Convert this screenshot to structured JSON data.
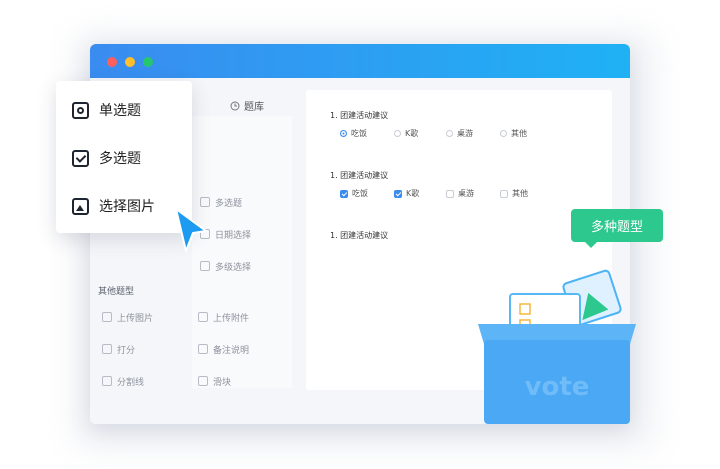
{
  "library": {
    "title": "题库",
    "items": [
      "多选题",
      "日期选择",
      "多级选择"
    ],
    "section_label": "其他题型",
    "other_items": [
      "上传图片",
      "上传附件",
      "打分",
      "备注说明",
      "分割线",
      "滑块"
    ]
  },
  "popup": {
    "items": [
      "单选题",
      "多选题",
      "选择图片"
    ]
  },
  "form": {
    "q1": {
      "title": "1. 团建活动建议",
      "options": [
        "吃饭",
        "K歌",
        "桌游",
        "其他"
      ],
      "selected": 0
    },
    "q2": {
      "title": "1. 团建活动建议",
      "options": [
        "吃饭",
        "K歌",
        "桌游",
        "其他"
      ],
      "checked": [
        0,
        1
      ]
    },
    "q3": {
      "title": "1. 团建活动建议"
    }
  },
  "badge": {
    "label": "多种题型"
  },
  "vote": {
    "label": "vote"
  },
  "colors": {
    "accent": "#3a8cf0",
    "badge": "#2dc88e",
    "titlebar_start": "#3a8cf0",
    "titlebar_end": "#1fb1f4"
  }
}
